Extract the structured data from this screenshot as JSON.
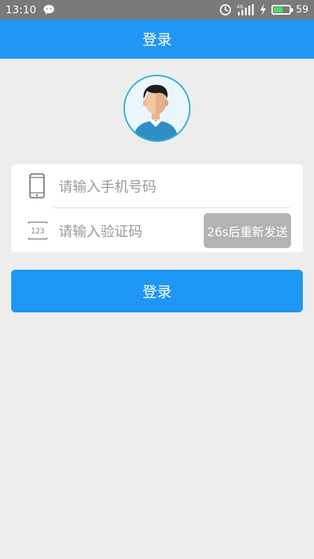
{
  "status_bar": {
    "time": "13:10",
    "network_label": "4G",
    "battery_percent": "59",
    "battery_level": 0.59,
    "icons": [
      "wechat-icon",
      "alarm-clock-icon",
      "signal-icon",
      "charging-icon",
      "battery-icon"
    ]
  },
  "header": {
    "title": "登录"
  },
  "form": {
    "phone_placeholder": "请输入手机号码",
    "phone_value": "",
    "code_placeholder": "请输入验证码",
    "code_value": "",
    "resend_label": "26s后重新发送",
    "phone_icon": "smartphone-icon",
    "code_icon": "numeric-code-icon"
  },
  "login_button": {
    "label": "登录"
  },
  "colors": {
    "primary": "#2196f3",
    "status_bar": "#7a7a7a",
    "background": "#ededed",
    "resend_disabled": "#b3b3b3",
    "battery": "#4cd964"
  }
}
